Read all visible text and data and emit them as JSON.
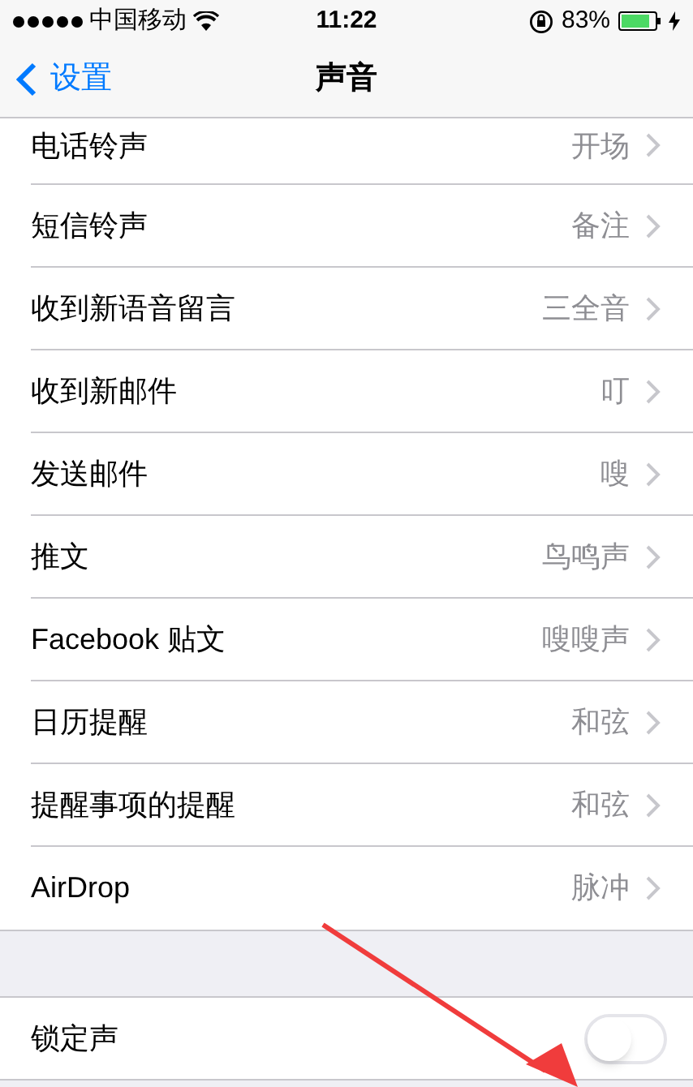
{
  "status_bar": {
    "carrier": "中国移动",
    "time": "11:22",
    "battery_percent": "83%"
  },
  "nav": {
    "back": "设置",
    "title": "声音"
  },
  "sounds": [
    {
      "label": "电话铃声",
      "value": "开场"
    },
    {
      "label": "短信铃声",
      "value": "备注"
    },
    {
      "label": "收到新语音留言",
      "value": "三全音"
    },
    {
      "label": "收到新邮件",
      "value": "叮"
    },
    {
      "label": "发送邮件",
      "value": "嗖"
    },
    {
      "label": "推文",
      "value": "鸟鸣声"
    },
    {
      "label": "Facebook 贴文",
      "value": "嗖嗖声"
    },
    {
      "label": "日历提醒",
      "value": "和弦"
    },
    {
      "label": "提醒事项的提醒",
      "value": "和弦"
    },
    {
      "label": "AirDrop",
      "value": "脉冲"
    }
  ],
  "toggles": [
    {
      "label": "锁定声",
      "on": false
    }
  ]
}
